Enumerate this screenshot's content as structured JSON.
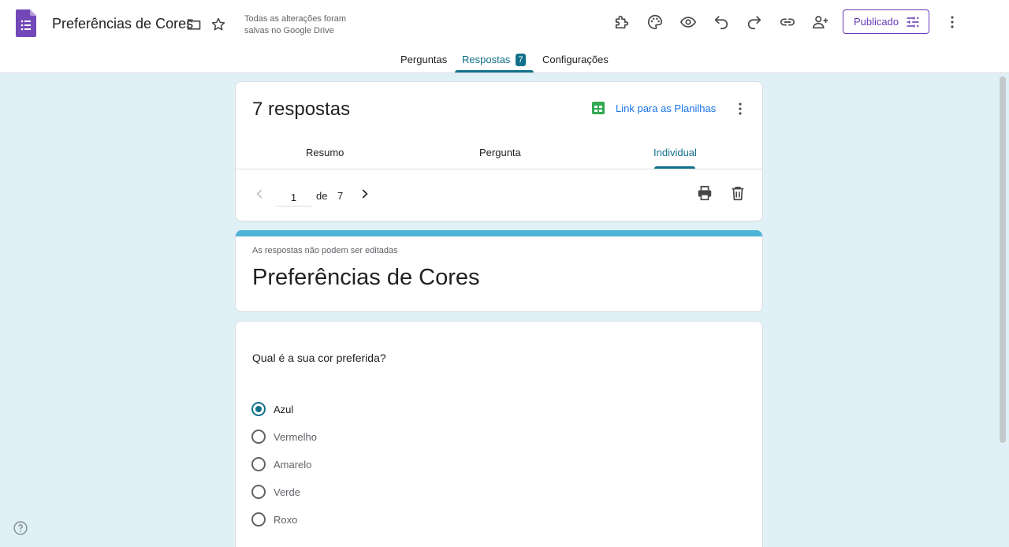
{
  "header": {
    "doc_title": "Preferências de Cores",
    "save_status": "Todas as alterações foram salvas no Google Drive",
    "publish_label": "Publicado",
    "icons": [
      "forms-logo-icon",
      "folder-icon",
      "star-icon",
      "addon-icon",
      "palette-icon",
      "preview-eye-icon",
      "undo-icon",
      "redo-icon",
      "link-icon",
      "add-collaborator-icon",
      "tune-icon",
      "more-vert-icon"
    ]
  },
  "tabs": [
    {
      "label": "Perguntas",
      "active": false
    },
    {
      "label": "Respostas",
      "active": true,
      "badge": "7"
    },
    {
      "label": "Configurações",
      "active": false
    }
  ],
  "summary": {
    "count_title": "7 respostas",
    "sheets_link": "Link para as Planilhas",
    "subtabs": [
      {
        "label": "Resumo",
        "active": false
      },
      {
        "label": "Pergunta",
        "active": false
      },
      {
        "label": "Individual",
        "active": true
      }
    ],
    "pager": {
      "current": "1",
      "of_label": "de",
      "total": "7"
    }
  },
  "form": {
    "note": "As respostas não podem ser editadas",
    "title": "Preferências de Cores"
  },
  "question": {
    "text": "Qual é a sua cor preferida?",
    "options": [
      {
        "label": "Azul",
        "selected": true
      },
      {
        "label": "Vermelho",
        "selected": false
      },
      {
        "label": "Amarelo",
        "selected": false
      },
      {
        "label": "Verde",
        "selected": false
      },
      {
        "label": "Roxo",
        "selected": false
      }
    ]
  },
  "colors": {
    "accent": "#12718a",
    "brand_purple": "#673ab7",
    "form_accent": "#4eb5d6",
    "background": "#dff1f7"
  }
}
